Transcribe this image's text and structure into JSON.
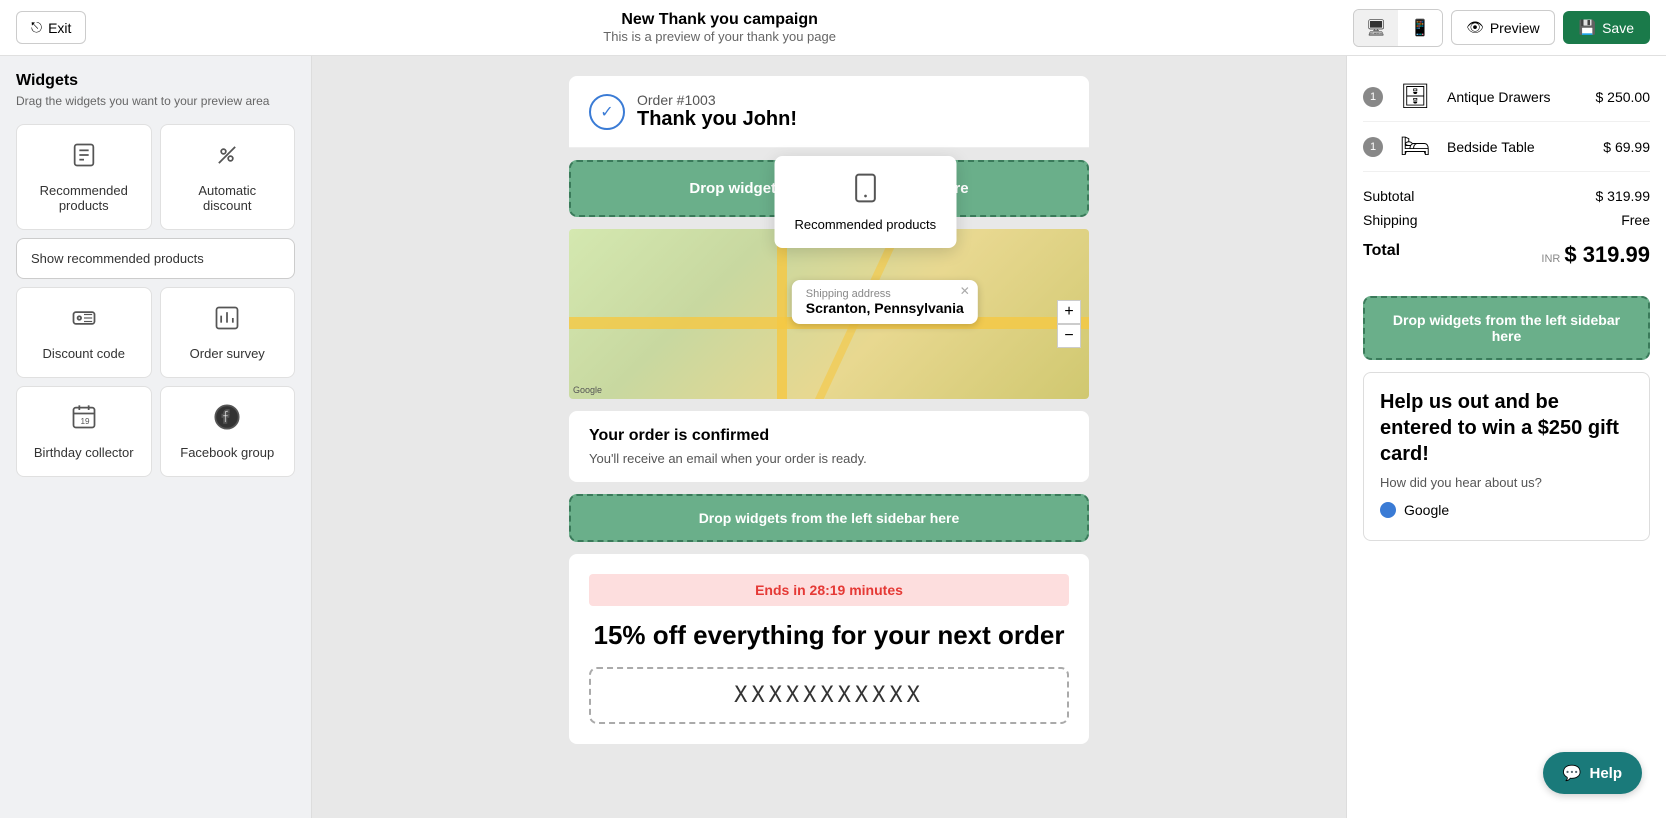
{
  "topbar": {
    "exit_label": "Exit",
    "title": "New Thank you campaign",
    "subtitle": "This is a preview of your thank you page",
    "preview_label": "Preview",
    "save_label": "Save"
  },
  "sidebar": {
    "title": "Widgets",
    "subtitle": "Drag the widgets you want to your preview area",
    "widgets": [
      {
        "id": "recommended-products",
        "label": "Recommended products",
        "icon": "page-icon"
      },
      {
        "id": "automatic-discount",
        "label": "Automatic discount",
        "icon": "percent-icon"
      },
      {
        "id": "show-recommended",
        "label": "Show recommended products",
        "icon": ""
      },
      {
        "id": "discount-code",
        "label": "Discount code",
        "icon": "coupon-icon"
      },
      {
        "id": "order-survey",
        "label": "Order survey",
        "icon": "chart-icon"
      },
      {
        "id": "birthday-collector",
        "label": "Birthday collector",
        "icon": "calendar-icon"
      },
      {
        "id": "facebook-group",
        "label": "Facebook group",
        "icon": "facebook-icon"
      }
    ]
  },
  "preview": {
    "order_number": "Order #1003",
    "thank_you": "Thank you John!",
    "drop_zone_top": "Drop widgets from the left sidebar here",
    "drop_zone_bottom": "Drop widgets from the left sidebar here",
    "shipping_label": "Shipping address",
    "shipping_address": "Scranton, Pennsylvania",
    "confirmed_title": "Your order is confirmed",
    "confirmed_body": "You'll receive an email when your order is ready.",
    "discount_timer": "Ends in 28:19 minutes",
    "discount_headline": "15% off everything for your next order",
    "discount_code": "XXXXXXXXXXX",
    "rec_tooltip_label": "Recommended products"
  },
  "right_panel": {
    "items": [
      {
        "badge": "1",
        "name": "Antique Drawers",
        "price": "$ 250.00"
      },
      {
        "badge": "1",
        "name": "Bedside Table",
        "price": "$ 69.99"
      }
    ],
    "subtotal_label": "Subtotal",
    "subtotal_value": "$ 319.99",
    "shipping_label": "Shipping",
    "shipping_value": "Free",
    "total_label": "Total",
    "total_currency": "INR",
    "total_value": "$ 319.99",
    "drop_zone": "Drop widgets from the left sidebar here",
    "survey": {
      "title": "Help us out and be entered to win a $250 gift card!",
      "subtitle": "How did you hear about us?",
      "options": [
        {
          "label": "Google",
          "selected": true
        }
      ]
    }
  },
  "help_label": "Help"
}
